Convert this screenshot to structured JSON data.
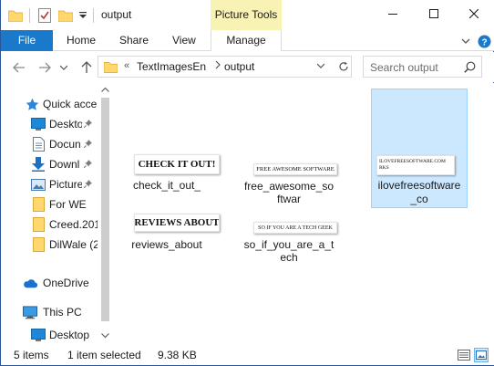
{
  "window": {
    "title": "output"
  },
  "contextual_tab": {
    "group": "Picture Tools",
    "tab": "Manage"
  },
  "ribbon": {
    "file": "File",
    "tabs": [
      "Home",
      "Share",
      "View"
    ]
  },
  "address": {
    "overflow": "«",
    "crumbs": [
      "TextImagesEn",
      "output"
    ]
  },
  "search": {
    "placeholder": "Search output"
  },
  "nav": {
    "items": [
      {
        "label": "Quick acce",
        "icon": "star-icon"
      },
      {
        "label": "Deskto",
        "icon": "desktop-icon",
        "pinned": true
      },
      {
        "label": "Docun",
        "icon": "document-icon",
        "pinned": true
      },
      {
        "label": "Downl",
        "icon": "download-icon",
        "pinned": true
      },
      {
        "label": "Picture",
        "icon": "pictures-icon",
        "pinned": true
      },
      {
        "label": "For WE",
        "icon": "folder-icon"
      },
      {
        "label": "Creed.201",
        "icon": "folder-icon"
      },
      {
        "label": "DilWale (2",
        "icon": "folder-icon"
      },
      {
        "label": "OneDrive",
        "icon": "cloud-icon"
      },
      {
        "label": "This PC",
        "icon": "computer-icon"
      },
      {
        "label": "Desktop",
        "icon": "desktop-icon"
      }
    ]
  },
  "files": [
    {
      "thumb_text": "CHECK IT OUT!",
      "name_lines": [
        "check_it_out_"
      ],
      "selected": false
    },
    {
      "thumb_text": "FREE AWESOME SOFTWARE",
      "name_lines": [
        "free_awesome_so",
        "ftwar"
      ],
      "selected": false
    },
    {
      "thumb_text": "ILOVEFREESOFTWARE.COM RKS",
      "name_lines": [
        "ilovefreesoftware",
        "_co"
      ],
      "selected": true
    },
    {
      "thumb_text": "REVIEWS ABOUT",
      "name_lines": [
        "reviews_about"
      ],
      "selected": false
    },
    {
      "thumb_text": "SO IF YOU ARE A TECH GEEK",
      "name_lines": [
        "so_if_you_are_a_t",
        "ech"
      ],
      "selected": false
    }
  ],
  "status": {
    "count": "5 items",
    "selected": "1 item selected",
    "size": "9.38 KB"
  },
  "colors": {
    "accent": "#1979ca",
    "context_tab": "#f8f2b4",
    "selection": "#cce8ff",
    "folder": "#ffd76e"
  }
}
